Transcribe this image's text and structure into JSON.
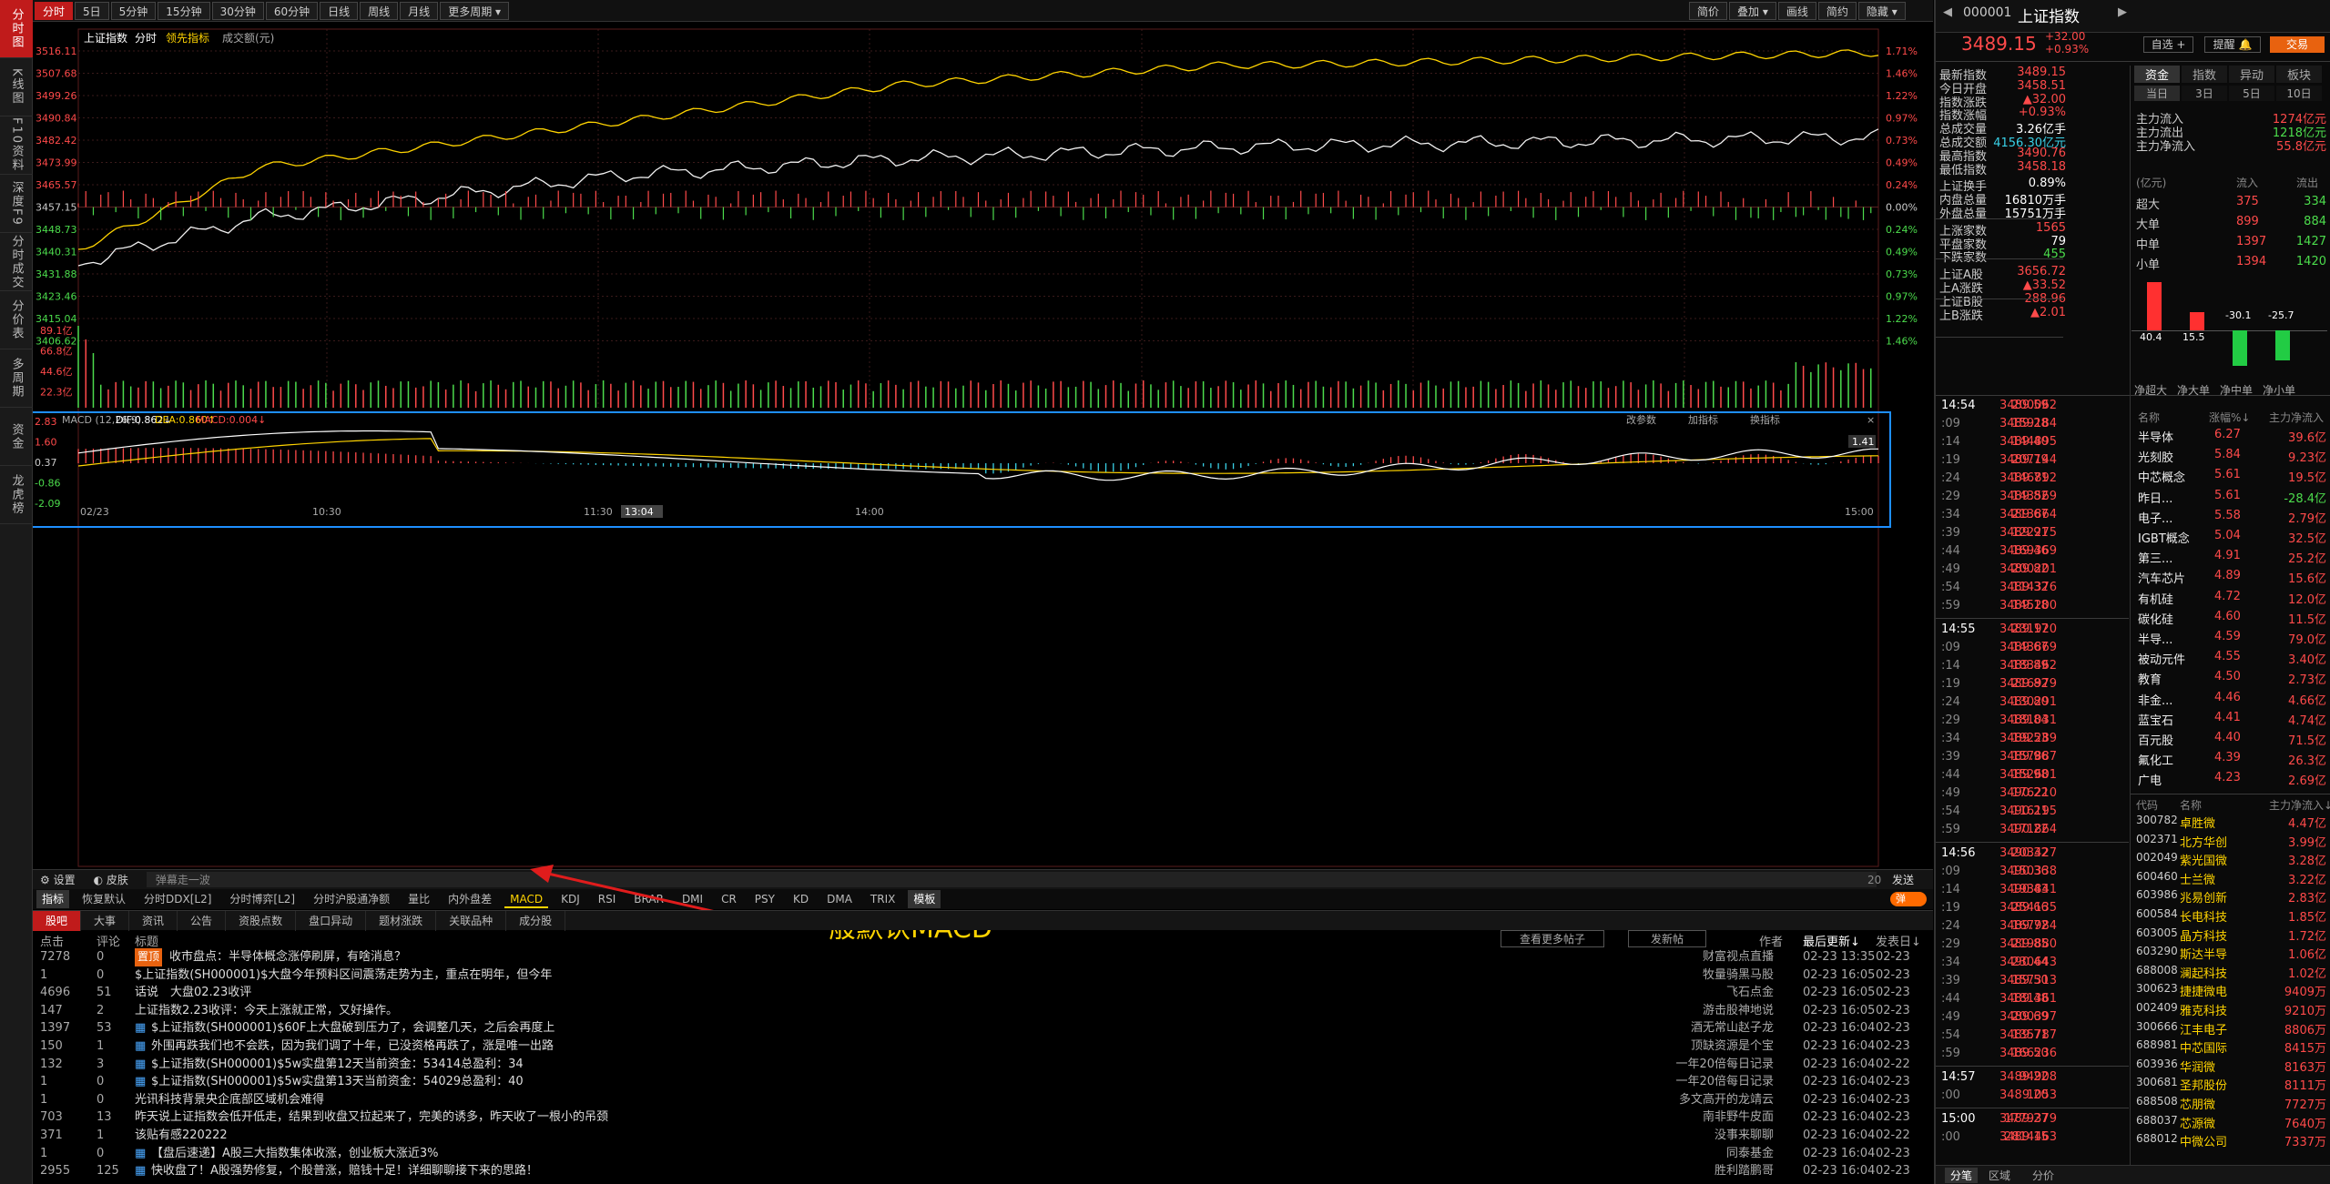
{
  "leftbar": {
    "tabs": [
      "分时图",
      "K线图",
      "F10资料",
      "深度F9",
      "分时成交",
      "分价表",
      "多周期",
      "资金",
      "龙虎榜"
    ]
  },
  "topbar": {
    "items": [
      "分时",
      "5日",
      "5分钟",
      "15分钟",
      "30分钟",
      "60分钟",
      "日线",
      "周线",
      "月线",
      "更多周期"
    ],
    "right": [
      "简价",
      "叠加",
      "画线",
      "简约",
      "隐藏"
    ]
  },
  "chart": {
    "legend": [
      "上证指数",
      "分时",
      "领先指标",
      "成交额(元)"
    ],
    "price_labels": [
      "3516.11",
      "3507.68",
      "3499.26",
      "3490.84",
      "3482.42",
      "3473.99",
      "3465.57",
      "3457.15",
      "3448.73",
      "3440.31",
      "3431.88",
      "3423.46",
      "3415.04",
      "3406.62"
    ],
    "pct_labels": [
      "1.71%",
      "1.46%",
      "1.22%",
      "0.97%",
      "0.73%",
      "0.49%",
      "0.24%",
      "0.00%",
      "0.24%",
      "0.49%",
      "0.73%",
      "0.97%",
      "1.22%",
      "1.46%"
    ],
    "vol_labels": [
      "89.1亿",
      "66.8亿",
      "44.6亿",
      "22.3亿"
    ],
    "macd_title": "MACD (12,26,9)",
    "dif": "DIF:0.862↓",
    "dea": "DEA:0.860↑",
    "macd": "MACD:0.004↓",
    "macd_buttons": [
      "改参数",
      "加指标",
      "换指标"
    ],
    "macd_labels": [
      "2.83",
      "1.60",
      "0.37",
      "-0.86",
      "-2.09"
    ],
    "macd_right": "1.41",
    "time_labels": [
      "02/23",
      "10:30",
      "11:30",
      "13:04",
      "14:00",
      "15:00"
    ]
  },
  "bottom": {
    "row1": [
      "设置",
      "皮肤",
      "弹幕走一波",
      "20",
      "发送"
    ],
    "tabs": [
      "指标",
      "恢复默认",
      "分时DDX[L2]",
      "分时博弈[L2]",
      "分时沪股通净额",
      "量比",
      "内外盘差",
      "MACD",
      "KDJ",
      "RSI",
      "BRAR",
      "DMI",
      "CR",
      "PSY",
      "KD",
      "DMA",
      "TRIX",
      "模板"
    ],
    "toggle": "弹"
  },
  "annotation": "一般默认MACD",
  "news": {
    "tabs": [
      "股吧",
      "大事",
      "资讯",
      "公告",
      "资股点数",
      "盘口异动",
      "题材涨跌",
      "关联品种",
      "成分股"
    ],
    "headers": [
      "点击",
      "评论",
      "标题",
      "作者",
      "最后更新↓",
      "发表日↓"
    ],
    "buttons": [
      "查看更多帖子",
      "发新帖"
    ],
    "rows": [
      [
        "7278",
        "0",
        "置顶",
        "收市盘点：半导体概念涨停刷屏，有啥消息？",
        "财富视点直播",
        "02-23 13:35",
        "02-23"
      ],
      [
        "1",
        "0",
        "",
        "$上证指数(SH000001)$大盘今年预料区间震荡走势为主，重点在明年，但今年",
        "牧量骑黑马股",
        "02-23 16:05",
        "02-23"
      ],
      [
        "4696",
        "51",
        "",
        "话说　大盘02.23收评",
        "飞石点金",
        "02-23 16:05",
        "02-23"
      ],
      [
        "147",
        "2",
        "",
        "上证指数2.23收评：今天上涨就正常，又好操作。",
        "游击股神地说",
        "02-23 16:05",
        "02-23"
      ],
      [
        "1397",
        "53",
        "",
        "$上证指数(SH000001)$60F上大盘破到压力了，会调整几天，之后会再度上",
        "酒无常山赵子龙",
        "02-23 16:04",
        "02-23"
      ],
      [
        "150",
        "1",
        "",
        "外围再跌我们也不会跌，因为我们调了十年，已没资格再跌了，涨是唯一出路",
        "顶缺资源是个宝",
        "02-23 16:04",
        "02-23"
      ],
      [
        "132",
        "3",
        "",
        "$上证指数(SH000001)$5w实盘第12天当前资金：53414总盈利：34",
        "一年20倍每日记录",
        "02-23 16:04",
        "02-22"
      ],
      [
        "1",
        "0",
        "",
        "$上证指数(SH000001)$5w实盘第13天当前资金：54029总盈利：40",
        "一年20倍每日记录",
        "02-23 16:04",
        "02-23"
      ],
      [
        "1",
        "0",
        "",
        "光讯科技背景央企底部区域机会难得",
        "多文高开的龙靖云",
        "02-23 16:04",
        "02-23"
      ],
      [
        "703",
        "13",
        "",
        "昨天说上证指数会低开低走，结果到收盘又拉起来了，完美的诱多，昨天收了一根小的吊颈",
        "南非野牛皮面",
        "02-23 16:04",
        "02-23"
      ],
      [
        "371",
        "1",
        "",
        "该贴有感220222",
        "没事来聊聊",
        "02-23 16:04",
        "02-22"
      ],
      [
        "1",
        "0",
        "",
        "【盘后速递】A股三大指数集体收涨，创业板大涨近3%",
        "同泰基金",
        "02-23 16:04",
        "02-23"
      ],
      [
        "2955",
        "125",
        "",
        "快收盘了！A股强势修复，个股普涨，赔钱十足！详细聊聊接下来的思路！",
        "胜利踏鹏哥",
        "02-23 16:04",
        "02-23"
      ]
    ]
  },
  "quote": {
    "code": "000001",
    "name": "上证指数",
    "price": "3489.15",
    "chg": "+32.00",
    "pct": "+0.93%",
    "buttons": [
      "自选 +",
      "提醒",
      "交易"
    ],
    "stats": [
      [
        "最新指数",
        "3489.15",
        "red"
      ],
      [
        "今日开盘",
        "3458.51",
        "red"
      ],
      [
        "指数涨跌",
        "▲32.00",
        "red"
      ],
      [
        "指数涨幅",
        "+0.93%",
        "red"
      ],
      [
        "总成交量",
        "3.26亿手",
        "white"
      ],
      [
        "总成交额",
        "4156.30亿元",
        "cyan"
      ],
      [
        "最高指数",
        "3490.76",
        "red"
      ],
      [
        "最低指数",
        "3458.18",
        "red"
      ],
      [
        "上证换手",
        "0.89%",
        "white"
      ],
      [
        "内盘总量",
        "16810万手",
        "white"
      ],
      [
        "外盘总量",
        "15751万手",
        "white"
      ],
      [
        "上涨家数",
        "1565",
        "red"
      ],
      [
        "平盘家数",
        "79",
        "white"
      ],
      [
        "下跌家数",
        "455",
        "green"
      ],
      [
        "上证A股",
        "3656.72",
        "red"
      ],
      [
        "上A涨跌",
        "▲33.52",
        "red"
      ],
      [
        "上证B股",
        "288.96",
        "red"
      ],
      [
        "上B涨跌",
        "▲2.01",
        "red"
      ]
    ],
    "fund_tabs": [
      "资金",
      "指数",
      "异动",
      "板块"
    ],
    "fund_subtabs": [
      "当日",
      "3日",
      "5日",
      "10日"
    ],
    "fund_main": [
      [
        "主力流入",
        "1274亿元",
        "red"
      ],
      [
        "主力流出",
        "1218亿元",
        "green"
      ],
      [
        "主力净流入",
        "55.8亿元",
        "red"
      ]
    ],
    "fund_cols": [
      "(亿元)",
      "流入",
      "流出"
    ],
    "fund_rows": [
      [
        "超大",
        "375",
        "334"
      ],
      [
        "大单",
        "899",
        "884"
      ],
      [
        "中单",
        "1397",
        "1427"
      ],
      [
        "小单",
        "1394",
        "1420"
      ]
    ],
    "bar_values": [
      "40.4",
      "15.5",
      "-30.1",
      "-25.7"
    ],
    "bar_labels": [
      "净超大",
      "净大单",
      "净中单",
      "净小单"
    ],
    "sector_head": [
      "名称",
      "涨幅%↓",
      "主力净流入"
    ],
    "sectors": [
      [
        "半导体",
        "6.27",
        "39.6亿"
      ],
      [
        "光刻胶",
        "5.84",
        "9.23亿"
      ],
      [
        "中芯概念",
        "5.61",
        "19.5亿"
      ],
      [
        "昨日...",
        "5.61",
        "-28.4亿"
      ],
      [
        "电子...",
        "5.58",
        "2.79亿"
      ],
      [
        "IGBT概念",
        "5.04",
        "32.5亿"
      ],
      [
        "第三...",
        "4.91",
        "25.2亿"
      ],
      [
        "汽车芯片",
        "4.89",
        "15.6亿"
      ],
      [
        "有机硅",
        "4.72",
        "12.0亿"
      ],
      [
        "碳化硅",
        "4.60",
        "11.5亿"
      ],
      [
        "半导...",
        "4.59",
        "79.0亿"
      ],
      [
        "被动元件",
        "4.55",
        "3.40亿"
      ],
      [
        "教育",
        "4.50",
        "2.73亿"
      ],
      [
        "非金...",
        "4.46",
        "4.66亿"
      ],
      [
        "蓝宝石",
        "4.41",
        "4.74亿"
      ],
      [
        "百元股",
        "4.40",
        "71.5亿"
      ],
      [
        "氟化工",
        "4.39",
        "26.3亿"
      ],
      [
        "广电",
        "4.23",
        "2.69亿"
      ]
    ],
    "stock_head": [
      "代码",
      "名称",
      "主力净流入↓"
    ],
    "stocks": [
      [
        "300782",
        "卓胜微",
        "4.47亿"
      ],
      [
        "002371",
        "北方华创",
        "3.99亿"
      ],
      [
        "002049",
        "紫光国微",
        "3.28亿"
      ],
      [
        "600460",
        "士兰微",
        "3.22亿"
      ],
      [
        "603986",
        "兆易创新",
        "2.83亿"
      ],
      [
        "600584",
        "长电科技",
        "1.85亿"
      ],
      [
        "603005",
        "晶方科技",
        "1.72亿"
      ],
      [
        "603290",
        "斯达半导",
        "1.06亿"
      ],
      [
        "688008",
        "澜起科技",
        "1.02亿"
      ],
      [
        "300623",
        "捷捷微电",
        "9409万"
      ],
      [
        "002409",
        "雅克科技",
        "9210万"
      ],
      [
        "300666",
        "江丰电子",
        "8806万"
      ],
      [
        "688981",
        "中芯国际",
        "8415万"
      ],
      [
        "603936",
        "华润微",
        "8163万"
      ],
      [
        "300681",
        "圣邦股份",
        "8111万"
      ],
      [
        "688508",
        "芯朋微",
        "7727万"
      ],
      [
        "688037",
        "芯源微",
        "7640万"
      ],
      [
        "688012",
        "中微公司",
        "7337万"
      ]
    ],
    "ticks": [
      [
        "14:54",
        "3489.59",
        "200062",
        "r"
      ],
      [
        "09",
        "3489.28",
        "159184",
        "r"
      ],
      [
        "14",
        "3489.40",
        "144895",
        "r"
      ],
      [
        "19",
        "3489.79",
        "207144",
        "r"
      ],
      [
        "24",
        "3489.71",
        "146892",
        "r"
      ],
      [
        "29",
        "3489.82",
        "143569",
        "r"
      ],
      [
        "34",
        "3489.67",
        "213864",
        "r"
      ],
      [
        "39",
        "3489.91",
        "122275",
        "r"
      ],
      [
        "44",
        "3489.46",
        "169369",
        "r"
      ],
      [
        "49",
        "3489.82",
        "200201",
        "r"
      ],
      [
        "54",
        "3489.32",
        "114376",
        "r"
      ],
      [
        "59",
        "3489.18",
        "145200",
        "r"
      ],
      [
        "14:55",
        "3489.17",
        "231920",
        "r"
      ],
      [
        "09",
        "3489.67",
        "143869",
        "r"
      ],
      [
        "14",
        "3489.89",
        "183462",
        "r"
      ],
      [
        "19",
        "3489.82",
        "216979",
        "r"
      ],
      [
        "24",
        "3489.80",
        "130291",
        "r"
      ],
      [
        "29",
        "3489.84",
        "181031",
        "r"
      ],
      [
        "34",
        "3489.53",
        "192289",
        "r"
      ],
      [
        "39",
        "3489.96",
        "157887",
        "r"
      ],
      [
        "44",
        "3489.98",
        "152601",
        "r"
      ],
      [
        "49",
        "3490.22",
        "176210",
        "r"
      ],
      [
        "54",
        "3490.21",
        "116195",
        "r"
      ],
      [
        "59",
        "3490.22",
        "171864",
        "r"
      ],
      [
        "14:56",
        "3490.32",
        "203427",
        "r"
      ],
      [
        "09",
        "3490.36",
        "150338",
        "r"
      ],
      [
        "14",
        "3490.43",
        "193841",
        "r"
      ],
      [
        "19",
        "3489.66",
        "254135",
        "r"
      ],
      [
        "24",
        "3489.72",
        "167984",
        "r"
      ],
      [
        "29",
        "3489.85",
        "219880",
        "r"
      ],
      [
        "34",
        "3490.44",
        "230643",
        "r"
      ],
      [
        "39",
        "3489.50",
        "157313",
        "r"
      ],
      [
        "44",
        "3489.48",
        "181361",
        "r"
      ],
      [
        "49",
        "3489.69",
        "200397",
        "r"
      ],
      [
        "54",
        "3489.71",
        "135787",
        "r"
      ],
      [
        "59",
        "3489.50",
        "166236",
        "r"
      ],
      [
        "14:57",
        "3489.22",
        "94908",
        "r"
      ],
      [
        "00",
        "3489.20",
        "1053",
        "r"
      ],
      [
        "15:00",
        "3489.27",
        "1779379",
        "r"
      ],
      [
        "00",
        "3489.15",
        "2814463",
        "r"
      ]
    ],
    "bottom_tabs": [
      "分笔",
      "区域",
      "分价"
    ]
  }
}
